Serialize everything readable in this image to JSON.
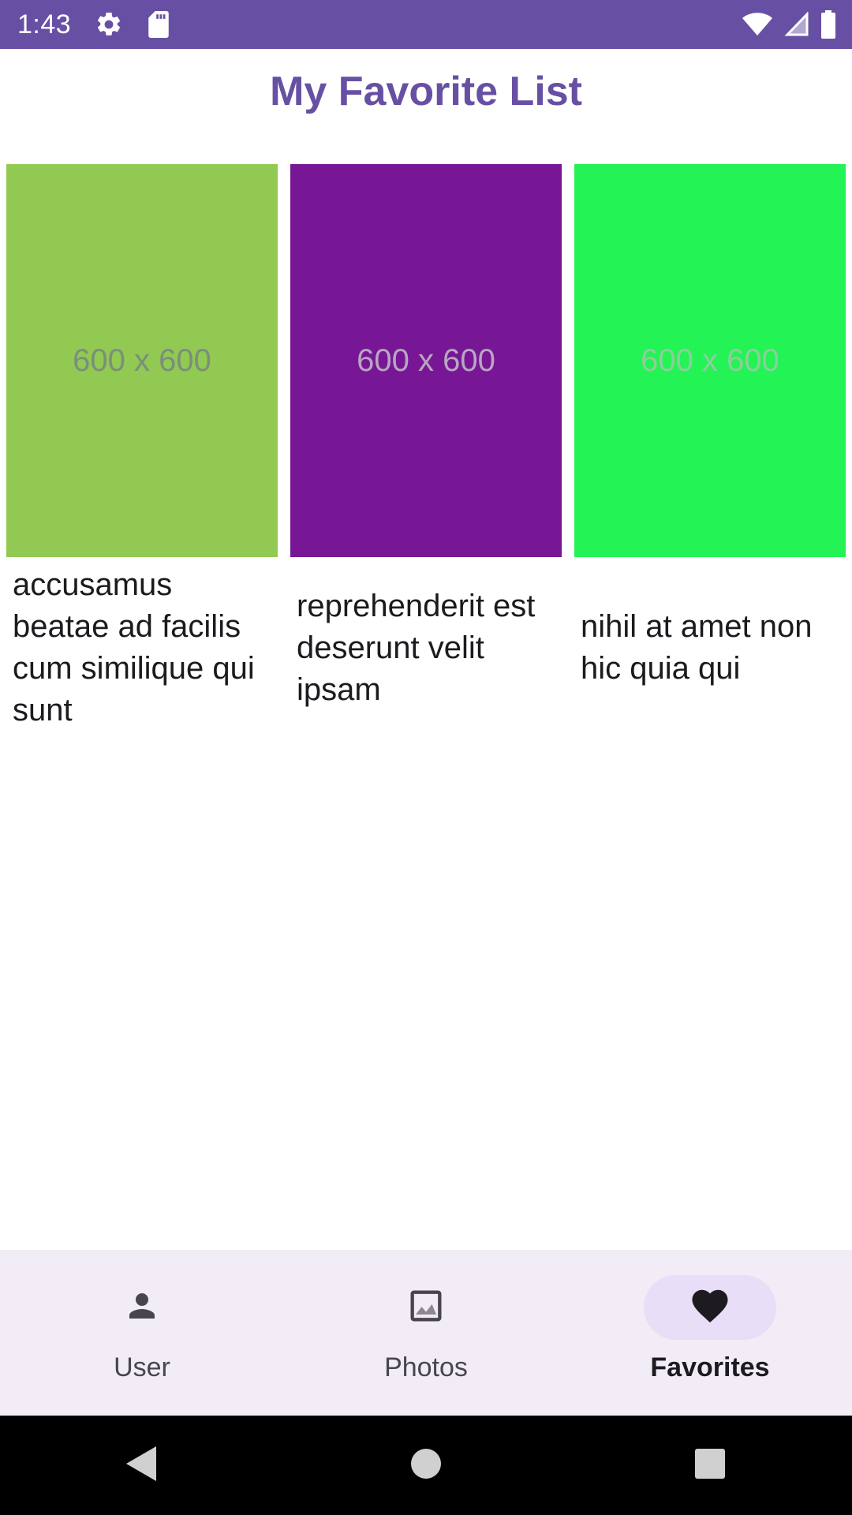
{
  "status_bar": {
    "time": "1:43",
    "icons": [
      "gear-icon",
      "sd-card-icon",
      "wifi-icon",
      "signal-icon",
      "battery-icon"
    ]
  },
  "page": {
    "title": "My Favorite List"
  },
  "favorites": [
    {
      "placeholder": "600 x 600",
      "color": "#92c952",
      "text_color": "#7a8f7a",
      "caption": "accusamus beatae ad facilis cum similique qui sunt"
    },
    {
      "placeholder": "600 x 600",
      "color": "#771796",
      "text_color": "#b9a6c0",
      "caption": "reprehenderit est deserunt velit ipsam"
    },
    {
      "placeholder": "600 x 600",
      "color": "#24f355",
      "text_color": "#8ccf9b",
      "caption": "nihil at amet non hic quia qui"
    }
  ],
  "bottom_nav": {
    "items": [
      {
        "label": "User",
        "icon": "person-icon",
        "active": false
      },
      {
        "label": "Photos",
        "icon": "image-icon",
        "active": false
      },
      {
        "label": "Favorites",
        "icon": "heart-icon",
        "active": true
      }
    ]
  },
  "system_nav": {
    "icons": [
      "back-icon",
      "home-icon",
      "recents-icon"
    ]
  },
  "colors": {
    "primary": "#6750a4",
    "nav_background": "#f2ecf6",
    "active_indicator": "#e8def8"
  }
}
